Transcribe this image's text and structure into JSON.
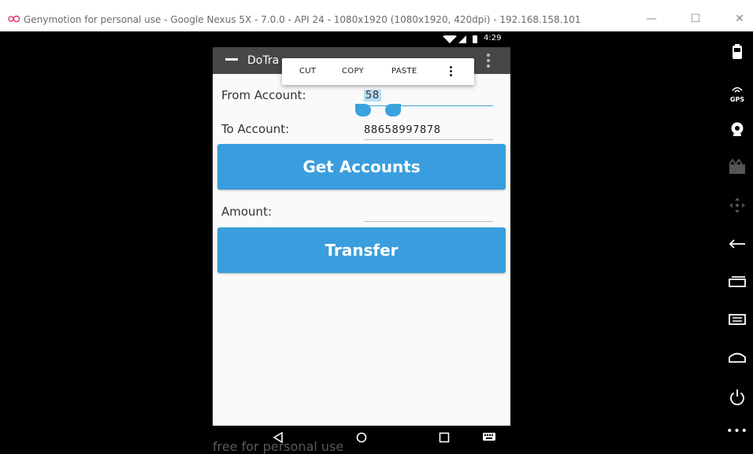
{
  "window": {
    "title": "Genymotion for personal use - Google Nexus 5X - 7.0.0 - API 24 - 1080x1920 (1080x1920, 420dpi) - 192.168.158.101",
    "minimize": "—",
    "maximize": "☐",
    "close": "✕",
    "accent": "#e0457b"
  },
  "status_bar": {
    "time": "4:29"
  },
  "action_bar": {
    "title": "DoTra"
  },
  "context_menu": {
    "items": [
      "CUT",
      "COPY",
      "PASTE"
    ]
  },
  "form": {
    "from_label": "From Account:",
    "from_value": "58",
    "to_label": "To Account:",
    "to_value": "88658997878",
    "amount_label": "Amount:",
    "amount_value": ""
  },
  "buttons": {
    "get_accounts": "Get Accounts",
    "transfer": "Transfer"
  },
  "watermark": "free for personal use",
  "sidebar": {
    "gps_label": "GPS",
    "more": "•••"
  },
  "colors": {
    "button": "#3a9ddd",
    "actionbar": "#474747",
    "selection": "#b6dcf3"
  }
}
